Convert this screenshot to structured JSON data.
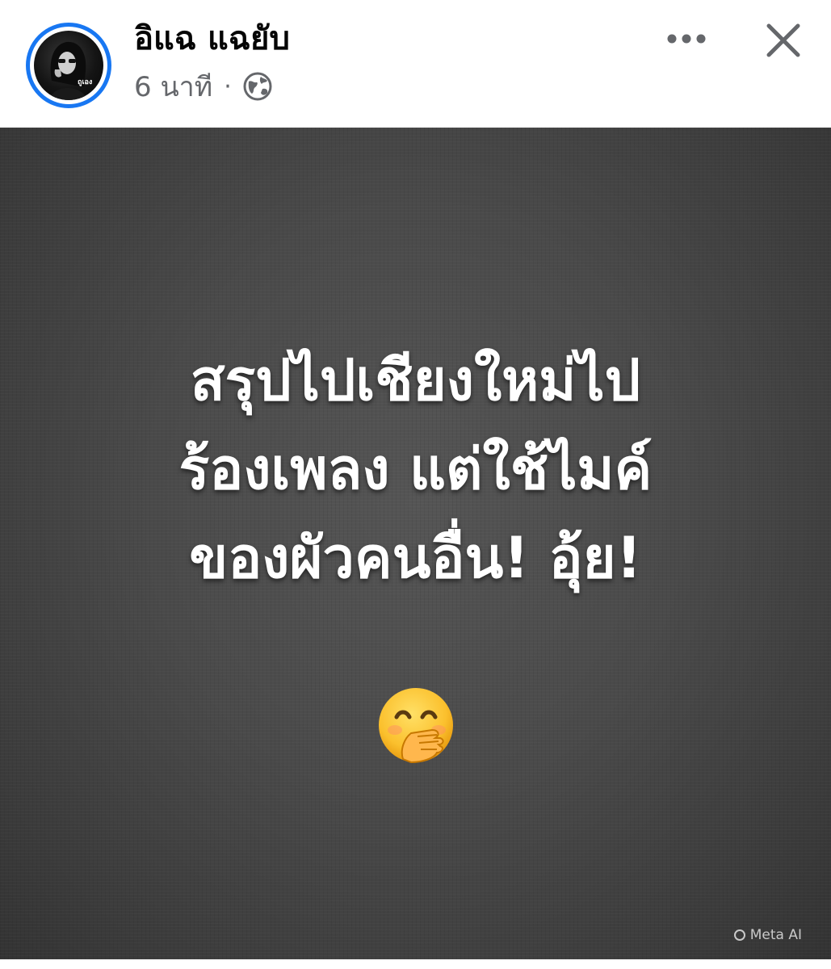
{
  "post": {
    "author_name": "อิแฉ แฉยับ",
    "timestamp": "6 นาที",
    "separator": "·",
    "privacy_icon": "globe-icon",
    "avatar_text": "ถูเอง",
    "more_icon": "more-horizontal-icon",
    "close_icon": "close-icon"
  },
  "image": {
    "text_lines": [
      "สรุปไปเชียงใหม่ไป",
      "ร้องเพลง แต่ใช้ไมค์",
      "ของผัวคนอื่น! อุ้ย!"
    ],
    "emoji": "hand-over-mouth-emoji",
    "watermark": "Meta AI"
  },
  "colors": {
    "avatar_ring": "#1877f2",
    "name_text": "#050505",
    "meta_text": "#65676b",
    "image_bg": "#4a4a4a",
    "image_text": "#ffffff"
  }
}
